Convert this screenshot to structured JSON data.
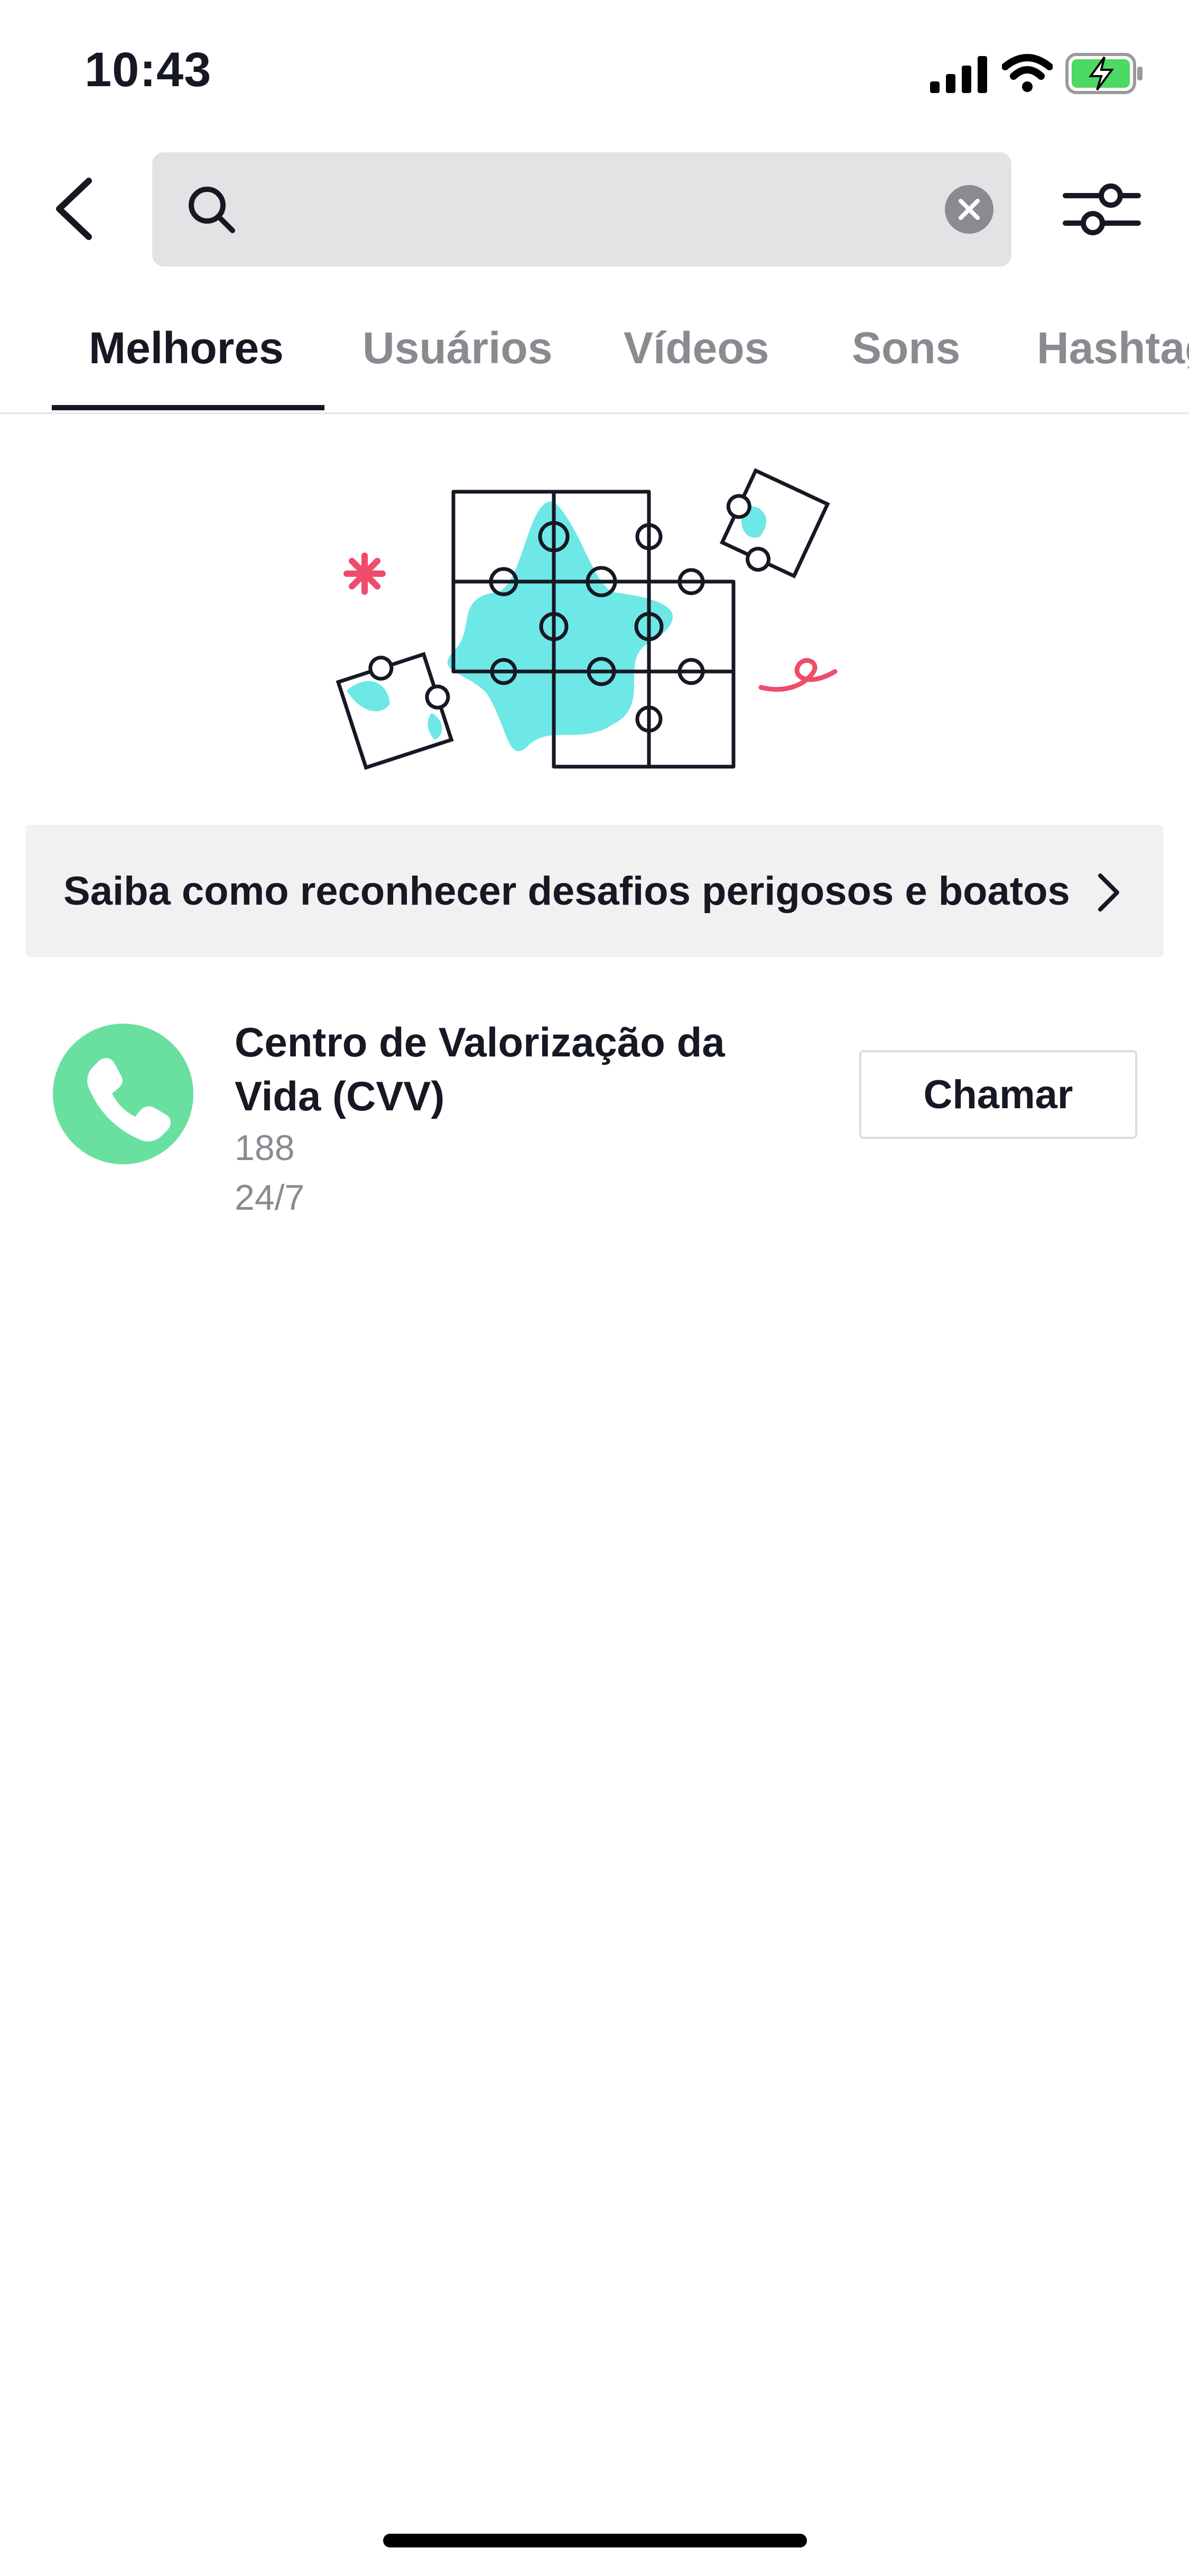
{
  "status_bar": {
    "time": "10:43",
    "icons": [
      "signal-icon",
      "wifi-icon",
      "battery-charging-icon"
    ]
  },
  "header": {
    "back_icon": "chevron-left-icon",
    "search": {
      "placeholder": "",
      "value": "",
      "icon": "search-icon",
      "clear_icon": "clear-icon"
    },
    "filter_icon": "filter-sliders-icon"
  },
  "tabs": [
    {
      "label": "Melhores",
      "active": true
    },
    {
      "label": "Usuários",
      "active": false
    },
    {
      "label": "Vídeos",
      "active": false
    },
    {
      "label": "Sons",
      "active": false
    },
    {
      "label": "Hashtags",
      "active": false
    }
  ],
  "illustration": {
    "name": "puzzle-illustration",
    "colors": {
      "accent": "#6ee8e6",
      "spark": "#ee4c6b"
    }
  },
  "banner": {
    "text": "Saiba como reconhecer desafios perigosos e boatos",
    "icon": "chevron-right-icon"
  },
  "helpline": {
    "name": "Centro de Valorização da Vida (CVV)",
    "number": "188",
    "hours": "24/7",
    "call_label": "Chamar",
    "avatar_color": "#69e0a0",
    "icon": "phone-icon"
  }
}
